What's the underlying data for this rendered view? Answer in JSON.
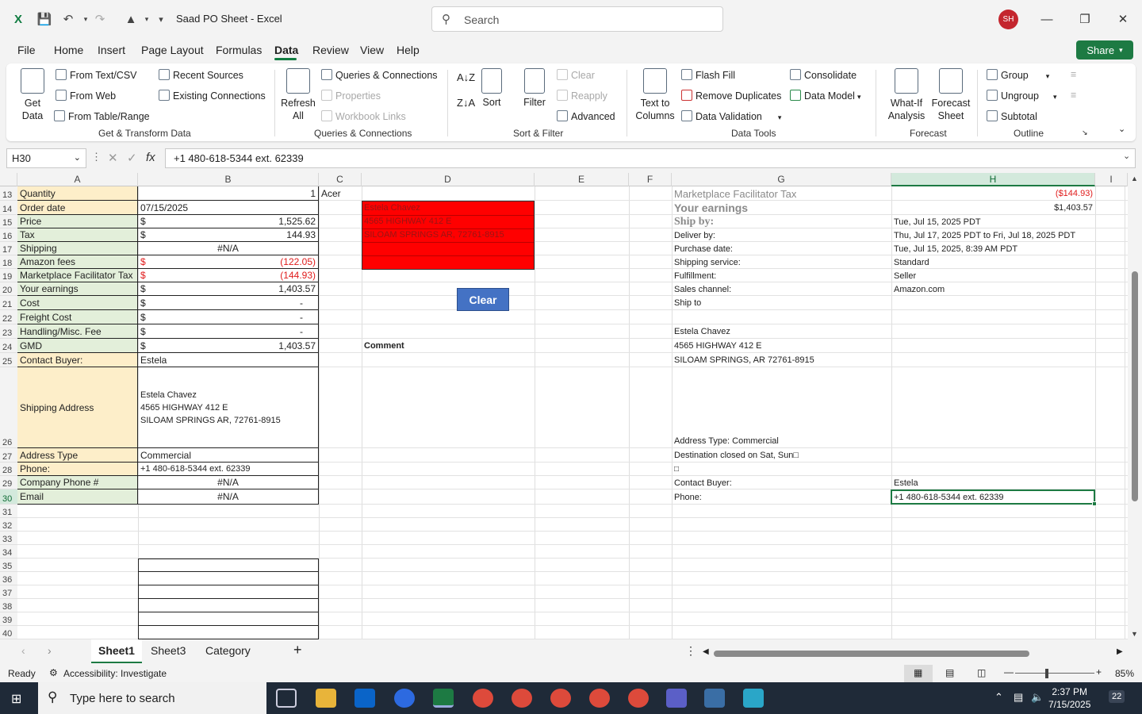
{
  "window": {
    "title": "Saad PO Sheet  -  Excel",
    "search_placeholder": "Search",
    "avatar": "SH",
    "colors": {
      "accent": "#107c41",
      "share": "#1d7a43",
      "avatar": "#c4262e"
    }
  },
  "menu": {
    "tabs": [
      "File",
      "Home",
      "Insert",
      "Page Layout",
      "Formulas",
      "Data",
      "Review",
      "View",
      "Help"
    ],
    "active": "Data",
    "share_label": "Share"
  },
  "ribbon": {
    "get_data": "Get\nData",
    "from_text": "From Text/CSV",
    "from_web": "From Web",
    "from_table": "From Table/Range",
    "recent_sources": "Recent Sources",
    "existing_connections": "Existing Connections",
    "group_get_transform": "Get & Transform Data",
    "refresh_all": "Refresh\nAll",
    "queries_connections": "Queries & Connections",
    "properties": "Properties",
    "workbook_links": "Workbook Links",
    "group_queries": "Queries & Connections",
    "sort": "Sort",
    "filter": "Filter",
    "clear": "Clear",
    "reapply": "Reapply",
    "advanced": "Advanced",
    "group_sort_filter": "Sort & Filter",
    "text_to_columns": "Text to\nColumns",
    "flash_fill": "Flash Fill",
    "remove_duplicates": "Remove Duplicates",
    "data_validation": "Data Validation",
    "consolidate": "Consolidate",
    "data_model": "Data Model",
    "group_data_tools": "Data Tools",
    "what_if": "What-If\nAnalysis",
    "forecast_sheet": "Forecast\nSheet",
    "group_forecast": "Forecast",
    "group": "Group",
    "ungroup": "Ungroup",
    "subtotal": "Subtotal",
    "group_outline": "Outline"
  },
  "formula_bar": {
    "name_box": "H30",
    "formula": "+1 480-618-5344 ext. 62339"
  },
  "columns": [
    "A",
    "B",
    "C",
    "D",
    "E",
    "F",
    "G",
    "H",
    "I"
  ],
  "selected_column": "H",
  "rows": [
    "13",
    "14",
    "15",
    "16",
    "17",
    "18",
    "19",
    "20",
    "21",
    "22",
    "23",
    "24",
    "25",
    "26",
    "27",
    "28",
    "29",
    "30",
    "31",
    "32",
    "33",
    "34",
    "35",
    "36",
    "37",
    "38",
    "39",
    "40"
  ],
  "selected_row": "30",
  "labels": {
    "quantity": "Quantity",
    "order_date": "Order date",
    "price": "Price",
    "tax": "Tax",
    "shipping": "Shipping",
    "amazon_fees": "Amazon fees",
    "mft": "Marketplace Facilitator Tax",
    "your_earnings": "Your earnings",
    "cost": "Cost",
    "freight_cost": "Freight Cost",
    "handling": "Handling/Misc. Fee",
    "gmd": "GMD",
    "contact_buyer": "Contact Buyer:",
    "shipping_address": "Shipping Address",
    "address_type": "Address Type",
    "phone": "Phone:",
    "company_phone": "Company Phone #",
    "email": "Email"
  },
  "values": {
    "quantity": "1",
    "brand": "Acer",
    "order_date": "07/15/2025",
    "currency": "$",
    "price": "1,525.62",
    "tax": "144.93",
    "shipping": "#N/A",
    "amazon_fees": "(122.05)",
    "mft": "(144.93)",
    "your_earnings": "1,403.57",
    "cost": "-",
    "freight_cost": "-",
    "handling": "-",
    "gmd": "1,403.57",
    "contact_buyer": "Estela",
    "addr1": "Estela Chavez",
    "addr2": "4565 HIGHWAY 412 E",
    "addr3": "SILOAM SPRINGS AR, 72761-8915",
    "addr3_b": "SILOAM SPRINGS AR, 72761-8915",
    "address_type": "Commercial",
    "phone": "+1 480-618-5344 ext. 62339",
    "company_phone": "#N/A",
    "email": "#N/A",
    "comment": "Comment",
    "clear_button": "Clear"
  },
  "red_block": [
    "Estela Chavez",
    "4565 HIGHWAY 412 E",
    "SILOAM SPRINGS AR, 72761-8915"
  ],
  "order_info": {
    "mft_label": "Marketplace Facilitator Tax",
    "mft_value": "($144.93)",
    "earnings_label": "Your earnings",
    "earnings_value": "$1,403.57",
    "ship_by_label": "Ship by:",
    "ship_by": "Tue, Jul 15, 2025 PDT",
    "deliver_by_label": "Deliver by:",
    "deliver_by": "Thu, Jul 17, 2025 PDT to Fri, Jul 18, 2025 PDT",
    "purchase_date_label": "Purchase date:",
    "purchase_date": "Tue, Jul 15, 2025, 8:39 AM PDT",
    "shipping_service_label": "Shipping service:",
    "shipping_service": "Standard",
    "fulfillment_label": "Fulfillment:",
    "fulfillment": "Seller",
    "sales_channel_label": "Sales channel:",
    "sales_channel": "Amazon.com",
    "ship_to_label": "Ship to",
    "ship_name": "Estela Chavez",
    "ship_addr": "4565 HIGHWAY 412 E",
    "ship_city": "SILOAM SPRINGS, AR 72761-8915",
    "address_type_line": "Address Type:  Commercial",
    "destination_closed": "Destination closed on Sat, Sun□",
    "box_char": "□",
    "contact_buyer_label": "Contact Buyer:",
    "contact_buyer": "Estela",
    "phone_label": "Phone:",
    "phone": "+1 480-618-5344 ext. 62339"
  },
  "sheets": {
    "tabs": [
      "Sheet1",
      "Sheet3",
      "Category"
    ],
    "active": "Sheet1",
    "add": "+"
  },
  "status": {
    "ready": "Ready",
    "accessibility": "Accessibility: Investigate",
    "zoom": "85%"
  },
  "taskbar": {
    "search": "Type here to search",
    "time": "2:37 PM",
    "date": "7/15/2025",
    "notifications": "22"
  }
}
